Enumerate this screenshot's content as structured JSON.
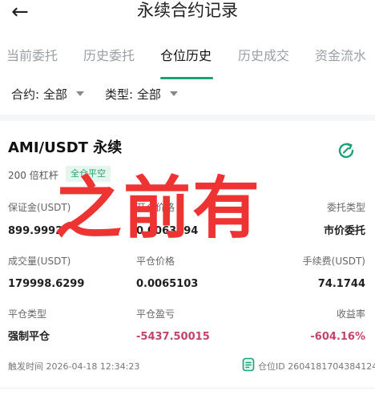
{
  "header": {
    "back_icon": "arrow-left-icon",
    "title": "永续合约记录"
  },
  "tabs": [
    {
      "label": "当前委托",
      "active": false
    },
    {
      "label": "历史委托",
      "active": false
    },
    {
      "label": "仓位历史",
      "active": true
    },
    {
      "label": "历史成交",
      "active": false
    },
    {
      "label": "资金流水",
      "active": false
    }
  ],
  "filters": {
    "contract": {
      "label": "合约:",
      "value": "全部"
    },
    "type": {
      "label": "类型:",
      "value": "全部"
    }
  },
  "position": {
    "pair": "AMI/USDT 永续",
    "leverage": "200 倍杠杆",
    "badge": "全仓平空",
    "fields": {
      "margin_label": "保证金(USDT)",
      "margin_value": "899.9992",
      "open_price_label": "开仓价格",
      "open_price_value": "0.0063194",
      "order_type_label": "委托类型",
      "order_type_value": "市价委托",
      "volume_label": "成交量(USDT)",
      "volume_value": "179998.6299",
      "close_price_label": "平仓价格",
      "close_price_value": "0.0065103",
      "fee_label": "手续费(USDT)",
      "fee_value": "74.1744",
      "close_type_label": "平仓类型",
      "close_type_value": "强制平仓",
      "pnl_label": "平仓盈亏",
      "pnl_value": "-5437.50015",
      "roi_label": "收益率",
      "roi_value": "-604.16%"
    },
    "trigger_time": "触发时间 2026-04-18 12:34:23",
    "position_id": "仓位ID 2604181704384124"
  },
  "overlay_text": "之前有",
  "colors": {
    "accent": "#1aa37a",
    "negative": "#c2446c",
    "overlay": "#ee3333"
  }
}
